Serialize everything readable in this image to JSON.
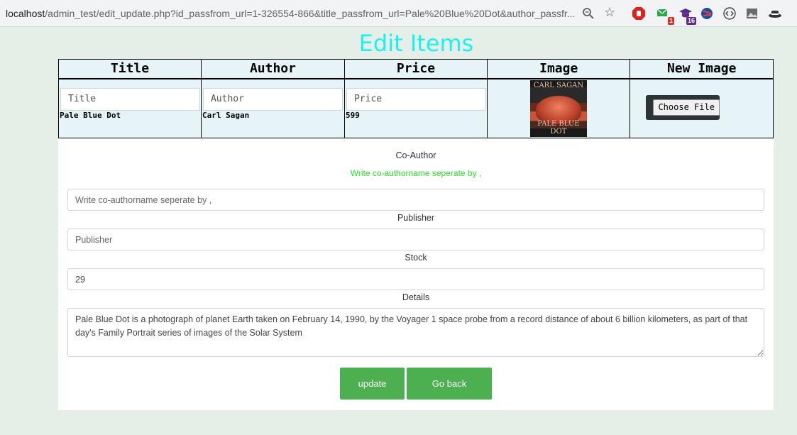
{
  "browser": {
    "url_host": "localhost",
    "url_path": "/admin_test/edit_update.php?id_passfrom_url=1-326554-866&title_passfrom_url=Pale%20Blue%20Dot&author_passfr...",
    "extension_badges": [
      "1",
      "16"
    ]
  },
  "page_title": "Edit Items",
  "table": {
    "headers": [
      "Title",
      "Author",
      "Price",
      "Image",
      "New Image"
    ],
    "placeholders": {
      "title": "Title",
      "author": "Author",
      "price": "Price"
    },
    "values": {
      "title": "Pale Blue Dot",
      "author": "Carl Sagan",
      "price": "599"
    },
    "image": {
      "top_text": "CARL SAGAN",
      "bottom_text": "PALE BLUE DOT"
    },
    "file_button_label": "Choose File"
  },
  "form": {
    "coauthor_label": "Co-Author",
    "coauthor_hint": "Write co-authorname seperate by ,",
    "coauthor_placeholder": "Write co-authorname seperate by ,",
    "publisher_label": "Publisher",
    "publisher_placeholder": "Publisher",
    "stock_label": "Stock",
    "stock_value": "29",
    "details_label": "Details",
    "details_value": "Pale Blue Dot is a photograph of planet Earth taken on February 14, 1990, by the Voyager 1 space probe from a record distance of about 6 billion kilometers, as part of that day's Family Portrait series of images of the Solar System",
    "update_button": "update",
    "back_button": "Go back"
  },
  "colors": {
    "title": "#1cf0f0",
    "hint": "#28e028",
    "button": "#4caf50",
    "page_background": "#e6efe7",
    "table_background": "#e6f4f7"
  }
}
